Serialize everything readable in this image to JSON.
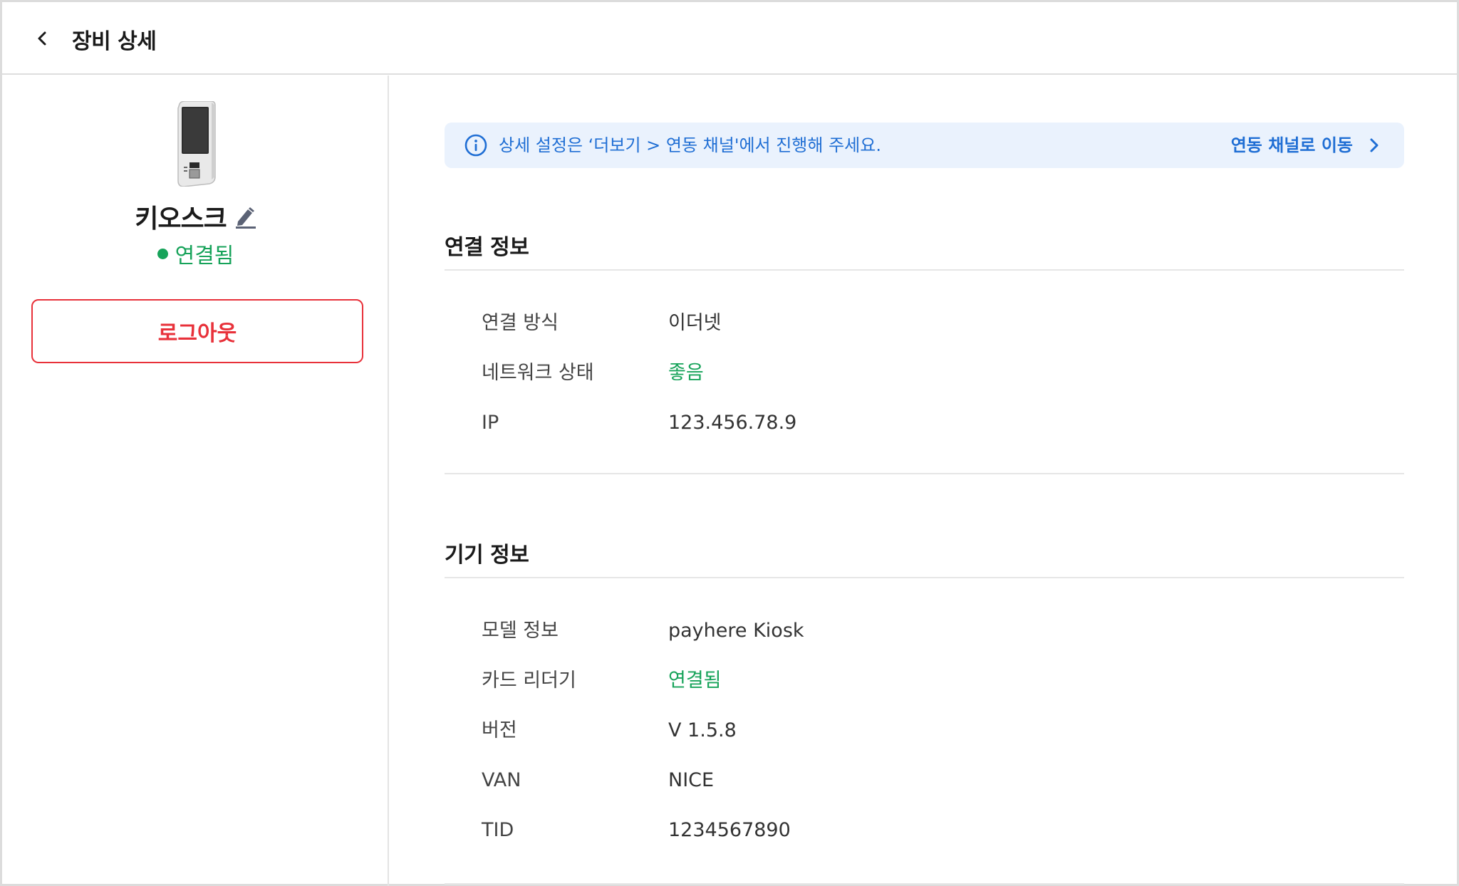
{
  "header": {
    "title": "장비 상세",
    "back_icon": "chevron-left-icon"
  },
  "sidebar": {
    "device_name": "키오스크",
    "edit_icon": "pencil-icon",
    "status": "연결됨",
    "status_color": "#17a35a",
    "logout_label": "로그아웃",
    "logout_color": "#e8313a"
  },
  "banner": {
    "icon": "info-icon",
    "text": "상세 설정은 ‘더보기 > 연동 채널'에서 진행해 주세요.",
    "link_label": "연동 채널로 이동",
    "link_icon": "chevron-right-icon",
    "accent": "#1f6ed4"
  },
  "connection": {
    "title": "연결 정보",
    "rows": [
      {
        "label": "연결 방식",
        "value": "이더넷"
      },
      {
        "label": "네트워크 상태",
        "value": "좋음"
      },
      {
        "label": "IP",
        "value": "123.456.78.9"
      }
    ]
  },
  "device": {
    "title": "기기 정보",
    "rows": [
      {
        "label": "모델 정보",
        "value": "payhere Kiosk"
      },
      {
        "label": "카드 리더기",
        "value": "연결됨"
      },
      {
        "label": "버전",
        "value": "V 1.5.8"
      },
      {
        "label": "VAN",
        "value": "NICE"
      },
      {
        "label": "TID",
        "value": "1234567890"
      }
    ]
  }
}
